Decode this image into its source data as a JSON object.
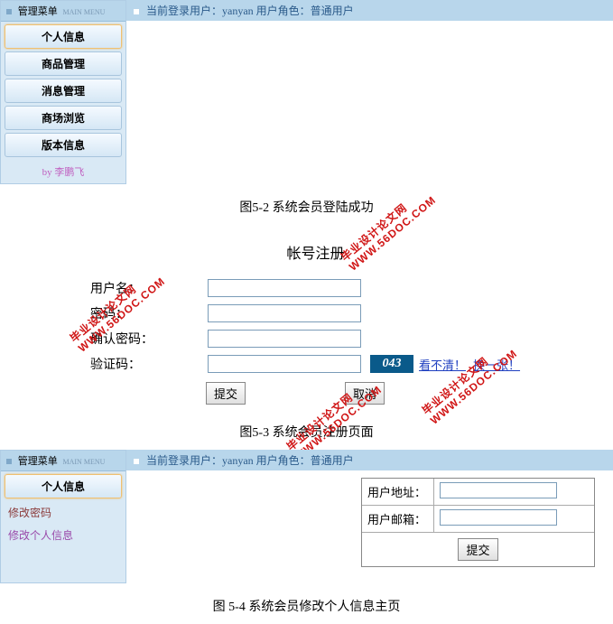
{
  "section1": {
    "sidebar_title": "管理菜单",
    "sidebar_title_en": "MAIN MENU",
    "menu": [
      "个人信息",
      "商品管理",
      "消息管理",
      "商场浏览",
      "版本信息"
    ],
    "footer": "by 李鹏飞",
    "header_status": "当前登录用户：yanyan 用户角色：普通用户"
  },
  "caption1": "图5-2 系统会员登陆成功",
  "reg": {
    "title": "帐号注册",
    "labels": {
      "username": "用户名：",
      "password": "密码：",
      "confirm": "确认密码：",
      "captcha": "验证码："
    },
    "captcha_value": "043",
    "hint_text": "看不清！",
    "swap_text": "换一张！",
    "submit": "提交",
    "cancel": "取消"
  },
  "caption2": "图5-3 系统会员注册页面",
  "section3": {
    "sidebar_title": "管理菜单",
    "sidebar_title_en": "MAIN MENU",
    "menu_main": "个人信息",
    "sub1": "修改密码",
    "sub2": "修改个人信息",
    "header_status": "当前登录用户：yanyan 用户角色：普通用户",
    "addr_label": "用户地址：",
    "email_label": "用户邮箱：",
    "submit": "提交"
  },
  "caption3": "图 5-4 系统会员修改个人信息主页",
  "watermark": {
    "line1": "毕业设计论文网",
    "line2": "WWW.56DOC.COM"
  }
}
